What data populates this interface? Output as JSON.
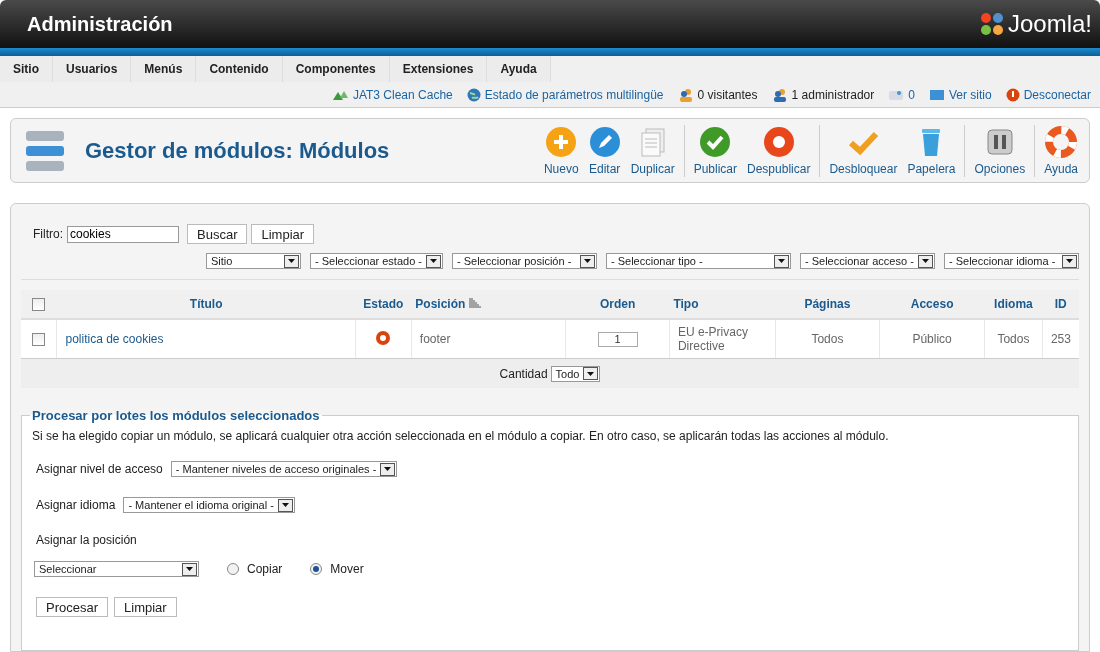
{
  "header": {
    "title": "Administración",
    "logo_text": "Joomla!"
  },
  "menu": [
    "Sitio",
    "Usuarios",
    "Menús",
    "Contenido",
    "Componentes",
    "Extensiones",
    "Ayuda"
  ],
  "status_links": [
    {
      "kind": "cache",
      "label": "JAT3 Clean Cache",
      "link": true
    },
    {
      "kind": "globe",
      "label": "Estado de parámetros multilingüe",
      "link": true
    },
    {
      "kind": "visitors",
      "label": "0 visitantes",
      "link": false
    },
    {
      "kind": "admins",
      "label": "1 administrador",
      "link": false
    },
    {
      "kind": "messages",
      "label": "0",
      "link": true
    },
    {
      "kind": "site",
      "label": "Ver sitio",
      "link": true
    },
    {
      "kind": "logout",
      "label": "Desconectar",
      "link": true
    }
  ],
  "toolbar": {
    "title": "Gestor de módulos: Módulos",
    "groups": [
      {
        "buttons": [
          {
            "kind": "new",
            "label": "Nuevo"
          },
          {
            "kind": "edit",
            "label": "Editar"
          },
          {
            "kind": "copy",
            "label": "Duplicar"
          }
        ]
      },
      {
        "buttons": [
          {
            "kind": "publish",
            "label": "Publicar"
          },
          {
            "kind": "unpublish",
            "label": "Despublicar"
          }
        ]
      },
      {
        "buttons": [
          {
            "kind": "checkin",
            "label": "Desbloquear"
          },
          {
            "kind": "trash",
            "label": "Papelera"
          }
        ]
      },
      {
        "buttons": [
          {
            "kind": "options",
            "label": "Opciones"
          }
        ]
      },
      {
        "buttons": [
          {
            "kind": "help",
            "label": "Ayuda"
          }
        ]
      }
    ]
  },
  "filter": {
    "label": "Filtro:",
    "value": "cookies",
    "buttons": [
      "Buscar",
      "Limpiar"
    ],
    "selects": [
      "Sitio",
      "- Seleccionar estado -",
      "- Seleccionar posición -",
      "- Seleccionar tipo -",
      "- Seleccionar acceso -",
      "- Seleccionar idioma -"
    ]
  },
  "table": {
    "select_all_checked": false,
    "columns": [
      {
        "label": "Título",
        "sortable": false
      },
      {
        "label": "Estado",
        "sortable": false
      },
      {
        "label": "Posición",
        "sortable": true
      },
      {
        "label": "Orden",
        "sortable": false
      },
      {
        "label": "Tipo",
        "sortable": false
      },
      {
        "label": "Páginas",
        "sortable": false
      },
      {
        "label": "Acceso",
        "sortable": false
      },
      {
        "label": "Idioma",
        "sortable": false
      },
      {
        "label": "ID",
        "sortable": false
      }
    ],
    "rows": [
      {
        "checked": false,
        "title": "politica de cookies",
        "published": false,
        "position": "footer",
        "order": "1",
        "type": "EU e-Privacy Directive",
        "pages": "Todos",
        "access": "Público",
        "language": "Todos",
        "id": "253"
      }
    ]
  },
  "pagination": {
    "label": "Cantidad",
    "value": "Todo"
  },
  "batch": {
    "legend": "Procesar por lotes los módulos seleccionados",
    "note": "Si se ha elegido copiar un módulo, se aplicará cualquier otra acción seleccionada en el módulo a copiar. En otro caso, se aplicarán todas las acciones al módulo.",
    "access": {
      "label": "Asignar nivel de acceso",
      "value": "- Mantener niveles de acceso originales -"
    },
    "language": {
      "label": "Asignar idioma",
      "value": "- Mantener el idioma original -"
    },
    "position": {
      "label": "Asignar la posición",
      "value": "Seleccionar"
    },
    "modes": [
      {
        "label": "Copiar",
        "selected": false
      },
      {
        "label": "Mover",
        "selected": true
      }
    ],
    "buttons": [
      "Procesar",
      "Limpiar"
    ]
  }
}
